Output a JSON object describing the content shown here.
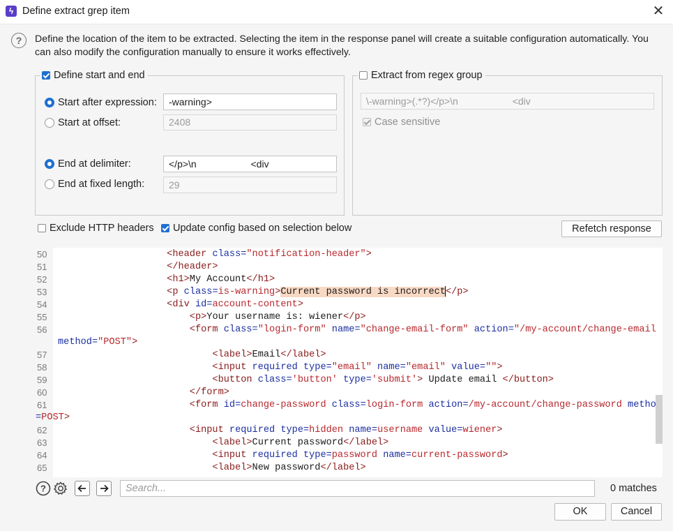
{
  "window": {
    "title": "Define extract grep item",
    "close_glyph": "✕"
  },
  "description": "Define the location of the item to be extracted. Selecting the item in the response panel will create a suitable configuration automatically. You can also modify the configuration manually to ensure it works effectively.",
  "start_end_group": {
    "label": "Define start and end",
    "checked": true,
    "start_after_label": "Start after expression:",
    "start_after_value": "-warning>",
    "start_offset_label": "Start at offset:",
    "start_offset_value": "2408",
    "end_delimiter_label": "End at delimiter:",
    "end_delimiter_value": "</p>\\n                    <div",
    "end_fixed_label": "End at fixed length:",
    "end_fixed_value": "29"
  },
  "regex_group": {
    "label": "Extract from regex group",
    "checked": false,
    "regex_value": "\\-warning>(.*?)</p>\\n                    <div",
    "case_sensitive_label": "Case sensitive",
    "case_sensitive_checked": true
  },
  "options": {
    "exclude_headers_label": "Exclude HTTP headers",
    "exclude_headers_checked": false,
    "update_config_label": "Update config based on selection below",
    "update_config_checked": true,
    "refetch_label": "Refetch response"
  },
  "code": {
    "line_numbers": [
      "50",
      "51",
      "52",
      "53",
      "54",
      "55",
      "56",
      "57",
      "58",
      "59",
      "60",
      "61",
      "62",
      "63",
      "64",
      "65"
    ]
  },
  "search": {
    "placeholder": "Search...",
    "matches": "0 matches"
  },
  "buttons": {
    "ok": "OK",
    "cancel": "Cancel"
  },
  "colors": {
    "accent": "#1f6fd1",
    "highlight": "#f8d9c4",
    "tag": "#8a1b1b",
    "attribute": "#1b2fa0",
    "value": "#b8282d"
  },
  "icons": [
    "help-icon",
    "settings-gear-icon",
    "arrow-left-icon",
    "arrow-right-icon",
    "close-icon",
    "app-logo-icon"
  ]
}
